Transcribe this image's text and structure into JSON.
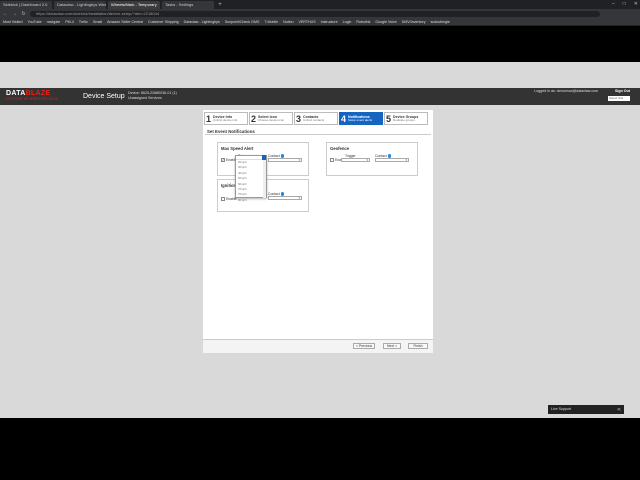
{
  "browser": {
    "tabs": [
      "Sidekick | Dashboard 2.0",
      "Dataclaw - Lightingbys Wire",
      "Wheels/Mark - Temporary",
      "Tasks - Settings"
    ],
    "active_tab": 2,
    "url": "https://dataclaw.com/sidekick/installation/device-setup/?dev=2218044",
    "bookmarks": [
      "Most Visited",
      "YouTube",
      "navigate",
      "PM-4",
      "Trello",
      "Gmail",
      "Amazon Seller Central",
      "Customer Shipping",
      "Dataclaw - Lightingbys",
      "Sunpoint/Check GMS",
      "T-Mobile",
      "Notion",
      "VERTHUS",
      "Instructure",
      "Login",
      "Robolink",
      "Google Voice",
      "DMV/Inventory",
      "sudocbingle"
    ],
    "controls": [
      "–",
      "□",
      "✕"
    ]
  },
  "app": {
    "logo_text_1": "DATA",
    "logo_text_2": "BLAZE",
    "logo_tagline": "LIGHTING UP WIRELESS DATA",
    "title": "Device Setup",
    "device_line_1": "Device: 8625-22680036-01 (1)",
    "device_line_2": "Unassigned Services",
    "logged_in": "Logged in as: dcmorrow@dataclaw.com",
    "signout": "Sign Out",
    "search_placeholder": "Select Site"
  },
  "steps": [
    {
      "num": "1",
      "title": "Device Info",
      "sub": "Unlimit device info"
    },
    {
      "num": "2",
      "title": "Select Icon",
      "sub": "Choose device icon"
    },
    {
      "num": "3",
      "title": "Contacts",
      "sub": "Unlimit contacts"
    },
    {
      "num": "4",
      "title": "Notifications",
      "sub": "Setup event alerts"
    },
    {
      "num": "5",
      "title": "Device Groups",
      "sub": "Dedicate groups"
    }
  ],
  "active_step": 3,
  "section_title": "Set Event Notifications",
  "cards": {
    "max_speed": {
      "title": "Max Speed Alert",
      "enable": "Enable",
      "enabled": true,
      "trigger_label": "Trigger",
      "contact_label": "Contact"
    },
    "geofence": {
      "title": "Geofence",
      "enable": "Enable",
      "enabled": false,
      "trigger_label": "Trigger",
      "contact_label": "Contact"
    },
    "ignition": {
      "title": "Ignition",
      "enable": "Enable",
      "enabled": false,
      "contact_label": "Contact"
    }
  },
  "dropdown_options": [
    "20mph",
    "30mph",
    "40mph",
    "50mph",
    "60mph",
    "70mph",
    "75mph",
    "80mph"
  ],
  "buttons": {
    "previous": "< Previous",
    "next": "Next >",
    "finish": "Finish"
  },
  "live_support": "Live Support",
  "colors": {
    "accent": "#1565c0",
    "brand_red": "#e2231a"
  }
}
